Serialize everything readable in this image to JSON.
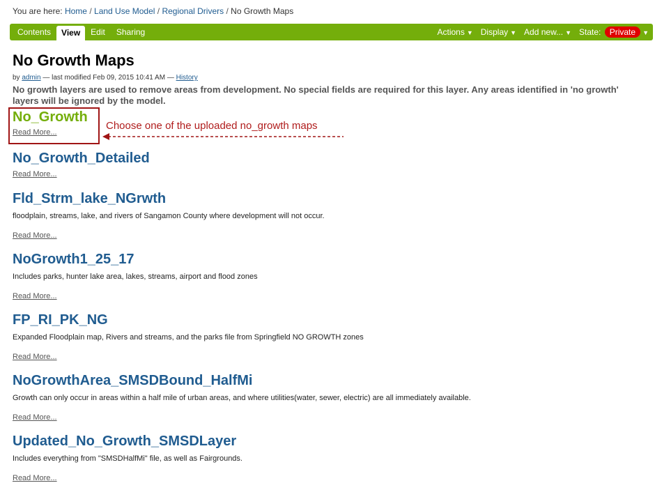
{
  "breadcrumb": {
    "prefix": "You are here:",
    "items": [
      "Home",
      "Land Use Model",
      "Regional Drivers",
      "No Growth Maps"
    ]
  },
  "tabs": [
    {
      "label": "Contents"
    },
    {
      "label": "View"
    },
    {
      "label": "Edit"
    },
    {
      "label": "Sharing"
    }
  ],
  "actions": [
    {
      "label": "Actions"
    },
    {
      "label": "Display"
    },
    {
      "label": "Add new..."
    }
  ],
  "state": {
    "label": "State:",
    "value": "Private"
  },
  "page": {
    "title": "No Growth Maps",
    "byline": {
      "by": "by",
      "author": "admin",
      "modified": "— last modified Feb 09, 2015 10:41 AM —",
      "history": "History"
    },
    "description": "No growth layers are used to remove areas from development. No special fields are required for this layer. Any areas identified in 'no growth' layers will be ignored by the model."
  },
  "items": [
    {
      "title": "No_Growth",
      "desc": "",
      "read_more": "Read More..."
    },
    {
      "title": "No_Growth_Detailed",
      "desc": "",
      "read_more": "Read More..."
    },
    {
      "title": "Fld_Strm_lake_NGrwth",
      "desc": "floodplain, streams, lake, and rivers of Sangamon County where development will not occur.",
      "read_more": "Read More..."
    },
    {
      "title": "NoGrowth1_25_17",
      "desc": "Includes parks, hunter lake area, lakes, streams, airport and flood zones",
      "read_more": "Read More..."
    },
    {
      "title": "FP_RI_PK_NG",
      "desc": "Expanded Floodplain map, Rivers and streams, and the parks file from Springfield NO GROWTH zones",
      "read_more": "Read More..."
    },
    {
      "title": "NoGrowthArea_SMSDBound_HalfMi",
      "desc": "Growth can only occur in areas within a half mile of urban areas, and where utilities(water, sewer, electric) are all immediately available.",
      "read_more": "Read More..."
    },
    {
      "title": "Updated_No_Growth_SMSDLayer",
      "desc": "Includes everything from \"SMSDHalfMi\" file, as well as Fairgrounds.",
      "read_more": "Read More..."
    }
  ],
  "annotation": {
    "text": "Choose one of the uploaded no_growth maps"
  },
  "colors": {
    "toolbar": "#74ae0b",
    "link": "#205c90",
    "annotation": "#a01515",
    "state_badge": "#e00000"
  }
}
